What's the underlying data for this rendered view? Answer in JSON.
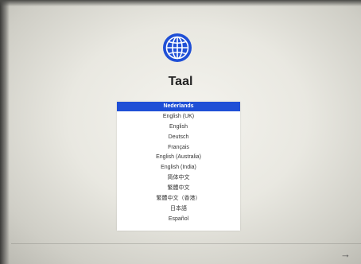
{
  "title": "Taal",
  "languages": [
    {
      "label": "Nederlands",
      "selected": true
    },
    {
      "label": "English (UK)",
      "selected": false
    },
    {
      "label": "English",
      "selected": false
    },
    {
      "label": "Deutsch",
      "selected": false
    },
    {
      "label": "Français",
      "selected": false
    },
    {
      "label": "English (Australia)",
      "selected": false
    },
    {
      "label": "English (India)",
      "selected": false
    },
    {
      "label": "简体中文",
      "selected": false
    },
    {
      "label": "繁體中文",
      "selected": false
    },
    {
      "label": "繁體中文（香港）",
      "selected": false
    },
    {
      "label": "日本語",
      "selected": false
    },
    {
      "label": "Español",
      "selected": false
    }
  ],
  "accent_color": "#1f4fd6",
  "icons": {
    "globe": "globe-icon",
    "next": "arrow-right-icon"
  },
  "next_arrow": "→"
}
